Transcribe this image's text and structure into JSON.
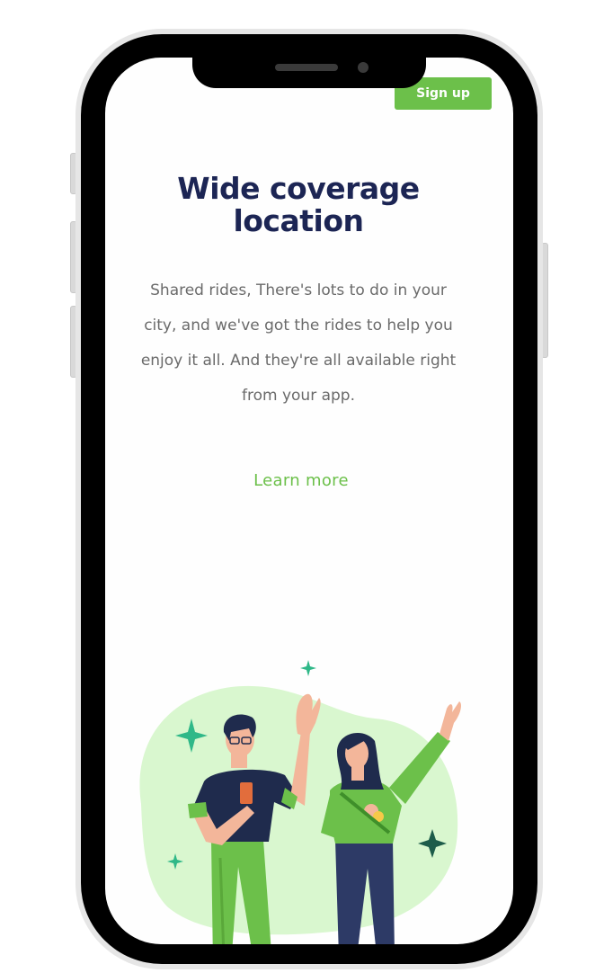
{
  "header": {
    "signup_label": "Sign up"
  },
  "hero": {
    "title_line1": "Wide coverage",
    "title_line2": "location",
    "description": "Shared rides, There's lots to do in your city, and we've got the rides to help you enjoy it all. And they're all available right from your app.",
    "cta_label": "Learn more"
  },
  "colors": {
    "brand_green": "#6cc04a",
    "title_navy": "#1c2554",
    "body_gray": "#6a6a6a",
    "blob_green": "#d9f7cf"
  },
  "illustration": {
    "icon": "people-waving-illustration"
  }
}
